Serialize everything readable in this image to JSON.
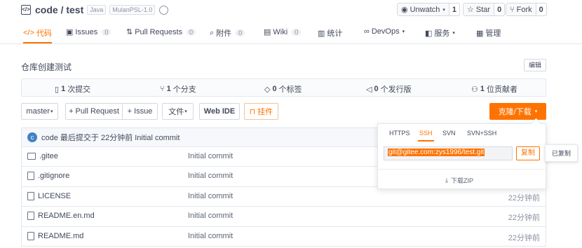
{
  "header": {
    "owner": "code",
    "separator": " / ",
    "repo": "test",
    "lang_tag": "Java",
    "license_tag": "MulanPSL-1.0"
  },
  "social": {
    "unwatch_label": "Unwatch",
    "unwatch_count": "1",
    "star_label": "Star",
    "star_count": "0",
    "fork_label": "Fork",
    "fork_count": "0"
  },
  "tabs": [
    {
      "label": "代码",
      "count": null
    },
    {
      "label": "Issues",
      "count": "0"
    },
    {
      "label": "Pull Requests",
      "count": "0"
    },
    {
      "label": "附件",
      "count": "0"
    },
    {
      "label": "Wiki",
      "count": "0"
    },
    {
      "label": "统计",
      "count": null
    },
    {
      "label": "DevOps",
      "count": null
    },
    {
      "label": "服务",
      "count": null
    },
    {
      "label": "管理",
      "count": null
    }
  ],
  "description": "仓库创建测试",
  "edit_label": "编辑",
  "stats": {
    "commits_num": "1",
    "commits_label": "次提交",
    "branches_num": "1",
    "branches_label": "个分支",
    "tags_num": "0",
    "tags_label": "个标签",
    "releases_num": "0",
    "releases_label": "个发行版",
    "contributors_num": "1",
    "contributors_label": "位贡献者"
  },
  "toolbar": {
    "branch": "master",
    "pull_request": "+ Pull Request",
    "issue": "+ Issue",
    "file": "文件",
    "web_ide": "Web IDE",
    "follow": "挂件",
    "clone": "克隆/下载"
  },
  "last_commit": {
    "avatar_letter": "c",
    "text": "code 最后提交于 22分钟前 Initial commit"
  },
  "files": [
    {
      "name": ".gitee",
      "type": "folder",
      "message": "Initial commit",
      "time": ""
    },
    {
      "name": ".gitignore",
      "type": "file",
      "message": "Initial commit",
      "time": ""
    },
    {
      "name": "LICENSE",
      "type": "file",
      "message": "Initial commit",
      "time": "22分钟前"
    },
    {
      "name": "README.en.md",
      "type": "file",
      "message": "Initial commit",
      "time": "22分钟前"
    },
    {
      "name": "README.md",
      "type": "file",
      "message": "Initial commit",
      "time": "22分钟前"
    }
  ],
  "clone_panel": {
    "tabs": [
      "HTTPS",
      "SSH",
      "SVN",
      "SVN+SSH"
    ],
    "active_tab": "SSH",
    "url": "git@gitee.com:zys1996/test.git",
    "copy_label": "复制",
    "download_zip": "下载ZIP"
  },
  "tooltip": "已复制",
  "colors": {
    "accent": "#fe7300",
    "text": "#40485b",
    "border": "#e3e7ee"
  }
}
